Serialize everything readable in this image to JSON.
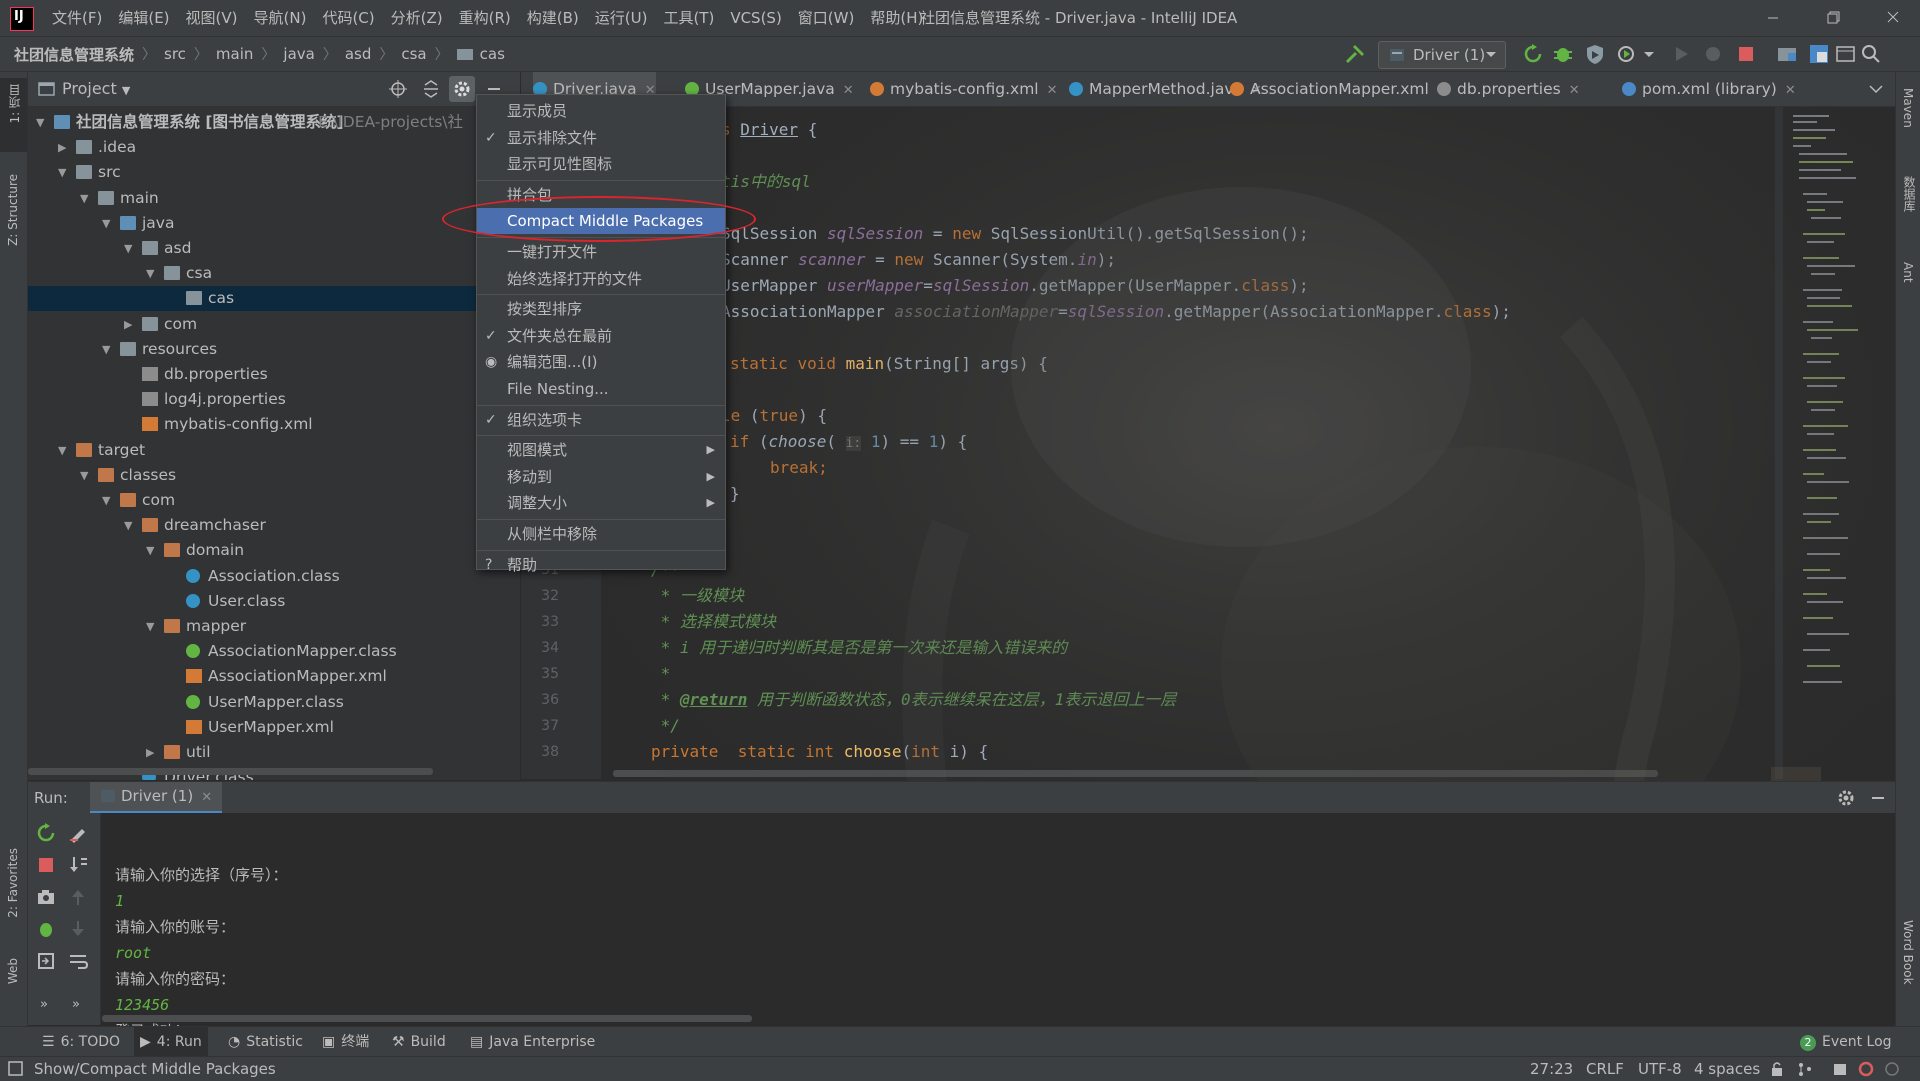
{
  "window": {
    "title": "社团信息管理系统 - Driver.java - IntelliJ IDEA",
    "menu": [
      "文件(F)",
      "编辑(E)",
      "视图(V)",
      "导航(N)",
      "代码(C)",
      "分析(Z)",
      "重构(R)",
      "构建(B)",
      "运行(U)",
      "工具(T)",
      "VCS(S)",
      "窗口(W)",
      "帮助(H)"
    ],
    "logo_letter": "IJ"
  },
  "breadcrumb": [
    "社团信息管理系统",
    "src",
    "main",
    "java",
    "asd",
    "csa",
    "cas"
  ],
  "run_config": {
    "label": "Driver (1)"
  },
  "left_stripe": {
    "project": "1: 项目",
    "structure": "Z: Structure",
    "favorites": "2: Favorites",
    "web": "Web"
  },
  "right_stripe": {
    "maven": "Maven",
    "database": "数据库",
    "ant": "Ant",
    "wordbook": "Word Book"
  },
  "project_panel": {
    "title": "Project",
    "tree": [
      {
        "label": "社团信息管理系统 [图书信息管理系统]",
        "extra": "E:\\IDEA-projects\\社",
        "depth": 0,
        "arrow": "down",
        "icon": "folder-b"
      },
      {
        "label": ".idea",
        "depth": 1,
        "arrow": "right",
        "icon": "folder"
      },
      {
        "label": "src",
        "depth": 1,
        "arrow": "down",
        "icon": "folder"
      },
      {
        "label": "main",
        "depth": 2,
        "arrow": "down",
        "icon": "folder"
      },
      {
        "label": "java",
        "depth": 3,
        "arrow": "down",
        "icon": "folder-b"
      },
      {
        "label": "asd",
        "depth": 4,
        "arrow": "down",
        "icon": "folder"
      },
      {
        "label": "csa",
        "depth": 5,
        "arrow": "down",
        "icon": "folder"
      },
      {
        "label": "cas",
        "depth": 6,
        "arrow": "",
        "icon": "folder",
        "selected": true
      },
      {
        "label": "com",
        "depth": 4,
        "arrow": "right",
        "icon": "folder"
      },
      {
        "label": "resources",
        "depth": 3,
        "arrow": "down",
        "icon": "folder"
      },
      {
        "label": "db.properties",
        "depth": 4,
        "arrow": "",
        "icon": "propic"
      },
      {
        "label": "log4j.properties",
        "depth": 4,
        "arrow": "",
        "icon": "propic"
      },
      {
        "label": "mybatis-config.xml",
        "depth": 4,
        "arrow": "",
        "icon": "xmlic"
      },
      {
        "label": "target",
        "depth": 1,
        "arrow": "down",
        "icon": "folder-o"
      },
      {
        "label": "classes",
        "depth": 2,
        "arrow": "down",
        "icon": "folder-o"
      },
      {
        "label": "com",
        "depth": 3,
        "arrow": "down",
        "icon": "folder-o"
      },
      {
        "label": "dreamchaser",
        "depth": 4,
        "arrow": "down",
        "icon": "folder-o"
      },
      {
        "label": "domain",
        "depth": 5,
        "arrow": "down",
        "icon": "folder-o"
      },
      {
        "label": "Association.class",
        "depth": 6,
        "arrow": "",
        "icon": "classic"
      },
      {
        "label": "User.class",
        "depth": 6,
        "arrow": "",
        "icon": "classic"
      },
      {
        "label": "mapper",
        "depth": 5,
        "arrow": "down",
        "icon": "folder-o"
      },
      {
        "label": "AssociationMapper.class",
        "depth": 6,
        "arrow": "",
        "icon": "ifc"
      },
      {
        "label": "AssociationMapper.xml",
        "depth": 6,
        "arrow": "",
        "icon": "xmlic"
      },
      {
        "label": "UserMapper.class",
        "depth": 6,
        "arrow": "",
        "icon": "ifc"
      },
      {
        "label": "UserMapper.xml",
        "depth": 6,
        "arrow": "",
        "icon": "xmlic"
      },
      {
        "label": "util",
        "depth": 5,
        "arrow": "right",
        "icon": "folder-o"
      },
      {
        "label": "Driver.class",
        "depth": 4,
        "arrow": "",
        "icon": "classic"
      }
    ]
  },
  "editor_tabs": [
    {
      "label": "Driver.java",
      "icon": "#3592c4",
      "active": true
    },
    {
      "label": "UserMapper.java",
      "icon": "#62b543"
    },
    {
      "label": "mybatis-config.xml",
      "icon": "#d47a37"
    },
    {
      "label": "MapperMethod.java",
      "icon": "#3592c4"
    },
    {
      "label": "AssociationMapper.xml",
      "icon": "#d47a37"
    },
    {
      "label": "db.properties",
      "icon": "#8c8c8c"
    },
    {
      "label": "pom.xml (library)",
      "icon": "#4a88c7"
    }
  ],
  "code": {
    "class_line": [
      "s ",
      "Driver",
      " {"
    ],
    "comment_line": "tis中的sql",
    "l1": [
      "SqlSession ",
      "sqlSession",
      " = ",
      "new",
      " SqlSessionUtil().getSqlSession();"
    ],
    "l2": [
      "Scanner ",
      "scanner",
      " = ",
      "new",
      " Scanner(System.",
      "in",
      ");"
    ],
    "l3": [
      "UserMapper ",
      "userMapper",
      "=",
      "sqlSession",
      ".getMapper(UserMapper.",
      "class",
      ");"
    ],
    "l4": [
      "AssociationMapper ",
      "associationMapper",
      "=",
      "sqlSession",
      ".getMapper(AssociationMapper.",
      "class",
      ");"
    ],
    "l5": [
      "static",
      " ",
      "void",
      " ",
      "main",
      "(String[] args) {"
    ],
    "l6": [
      "le",
      " (",
      "true",
      ") {"
    ],
    "l7": [
      "if",
      " (",
      "choose",
      "( ",
      "i:",
      " ",
      "1",
      ") == ",
      "1",
      ") {"
    ],
    "l8": [
      "break",
      ";"
    ],
    "l9": "}",
    "doc": [
      {
        "ln": "31",
        "text": "/**"
      },
      {
        "ln": "32",
        "text": " * 一级模块"
      },
      {
        "ln": "33",
        "text": " * 选择模式模块"
      },
      {
        "ln": "34",
        "text": " * i 用于递归时判断其是否是第一次来还是输入错误来的"
      },
      {
        "ln": "35",
        "text": " *"
      },
      {
        "ln": "36",
        "tag": "@return",
        "text": " 用于判断函数状态，0表示继续呆在这层，1表示退回上一层"
      },
      {
        "ln": "37",
        "text": " */"
      }
    ],
    "l38": {
      "ln": "38",
      "parts": [
        "private",
        "  ",
        "static",
        " ",
        "int",
        " ",
        "choose",
        "(",
        "int",
        " i) {"
      ]
    }
  },
  "context_menu": {
    "items": [
      {
        "label": "显示成员",
        "check": ""
      },
      {
        "label": "显示排除文件",
        "check": "✓"
      },
      {
        "label": "显示可见性图标",
        "check": ""
      },
      {
        "sep": true
      },
      {
        "label": "拼合包",
        "check": ""
      },
      {
        "label": "Compact Middle Packages",
        "check": "",
        "highlight": true
      },
      {
        "sep": true
      },
      {
        "label": "一键打开文件",
        "check": ""
      },
      {
        "label": "始终选择打开的文件",
        "check": ""
      },
      {
        "sep": true
      },
      {
        "label": "按类型排序",
        "check": ""
      },
      {
        "label": "文件夹总在最前",
        "check": "✓"
      },
      {
        "label": "编辑范围...(I)",
        "check": "◉"
      },
      {
        "label": "File Nesting...",
        "check": ""
      },
      {
        "sep": true
      },
      {
        "label": "组织选项卡",
        "check": "✓"
      },
      {
        "sep": true
      },
      {
        "label": "视图模式",
        "check": "",
        "submenu": true
      },
      {
        "label": "移动到",
        "check": "",
        "submenu": true
      },
      {
        "label": "调整大小",
        "check": "",
        "submenu": true
      },
      {
        "sep": true
      },
      {
        "label": "从侧栏中移除",
        "check": ""
      },
      {
        "sep": true
      },
      {
        "label": "帮助",
        "check": "?"
      }
    ]
  },
  "run_panel": {
    "label": "Run:",
    "tab": "Driver (1)",
    "output": [
      {
        "text": "请输入你的选择（序号）：",
        "kind": "sys"
      },
      {
        "text": "1",
        "kind": "usr"
      },
      {
        "text": "请输入你的账号：",
        "kind": "sys"
      },
      {
        "text": "root",
        "kind": "usr"
      },
      {
        "text": "请输入你的密码：",
        "kind": "sys"
      },
      {
        "text": "123456",
        "kind": "usr"
      },
      {
        "text": "登录成功!",
        "kind": "sys"
      }
    ]
  },
  "tool_windows": [
    {
      "label": "6: TODO"
    },
    {
      "label": "4: Run",
      "active": true
    },
    {
      "label": "Statistic"
    },
    {
      "label": "终端"
    },
    {
      "label": "Build"
    },
    {
      "label": "Java Enterprise"
    }
  ],
  "event_log": {
    "count": "2",
    "label": "Event Log"
  },
  "status": {
    "message": "Show/Compact Middle Packages",
    "position": "27:23",
    "line_sep": "CRLF",
    "encoding": "UTF-8",
    "indent": "4 spaces"
  },
  "colors": {
    "accent": "#4b6eaf",
    "selection": "#0d293e",
    "annotation_red": "#d9262e",
    "keyword": "#cc7832",
    "comment": "#629755",
    "field": "#9876aa",
    "output_user": "#62b543"
  }
}
